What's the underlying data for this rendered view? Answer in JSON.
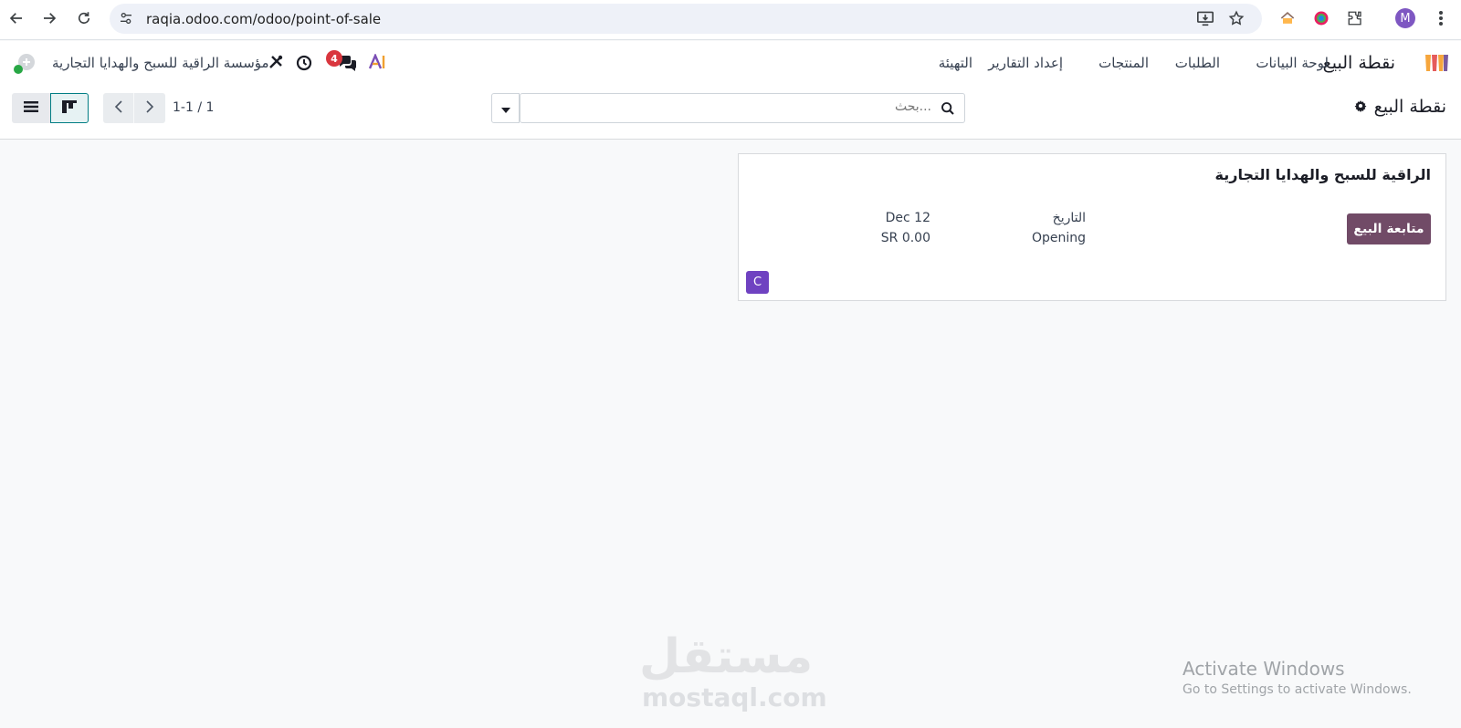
{
  "browser": {
    "url": "raqia.odoo.com/odoo/point-of-sale",
    "profile_initial": "M"
  },
  "navbar": {
    "app_name": "نقطة البيع",
    "menu": [
      "لوحة البيانات",
      "الطلبات",
      "المنتجات",
      "إعداد التقارير",
      "التهيئة"
    ],
    "company_name": "مؤسسة الراقية للسبح والهدايا التجارية",
    "messages_count": "4"
  },
  "control_panel": {
    "breadcrumb": "نقطة البيع",
    "search_placeholder": "بحث...",
    "pager": "1-1 / 1"
  },
  "card": {
    "title": "الراقية للسبح والهدايا التجارية",
    "continue_label": "متابعة البيع",
    "date_label": "التاريخ",
    "date_value": "Dec 12",
    "status_label": "Opening",
    "amount": "SR 0.00",
    "user_initial": "C"
  },
  "overlays": {
    "watermark_ar": "مستقل",
    "watermark_en": "mostaql.com",
    "activate_title": "Activate Windows",
    "activate_sub": "Go to Settings to activate Windows."
  },
  "colors": {
    "primary": "#714b67",
    "avatar_purple": "#6f42c1",
    "badge_red": "#d9363e",
    "active_view": "#017e84"
  },
  "icons": [
    "back-icon",
    "forward-icon",
    "reload-icon",
    "site-settings-icon",
    "install-icon",
    "star-icon",
    "extensions-icon",
    "menu-dots-icon",
    "pos-app-icon",
    "chat-icon",
    "clock-icon",
    "tools-icon",
    "ai-icon",
    "gear-icon",
    "search-icon",
    "caret-down-icon",
    "chevron-left-icon",
    "chevron-right-icon",
    "list-view-icon",
    "kanban-view-icon",
    "company-logo-icon"
  ]
}
